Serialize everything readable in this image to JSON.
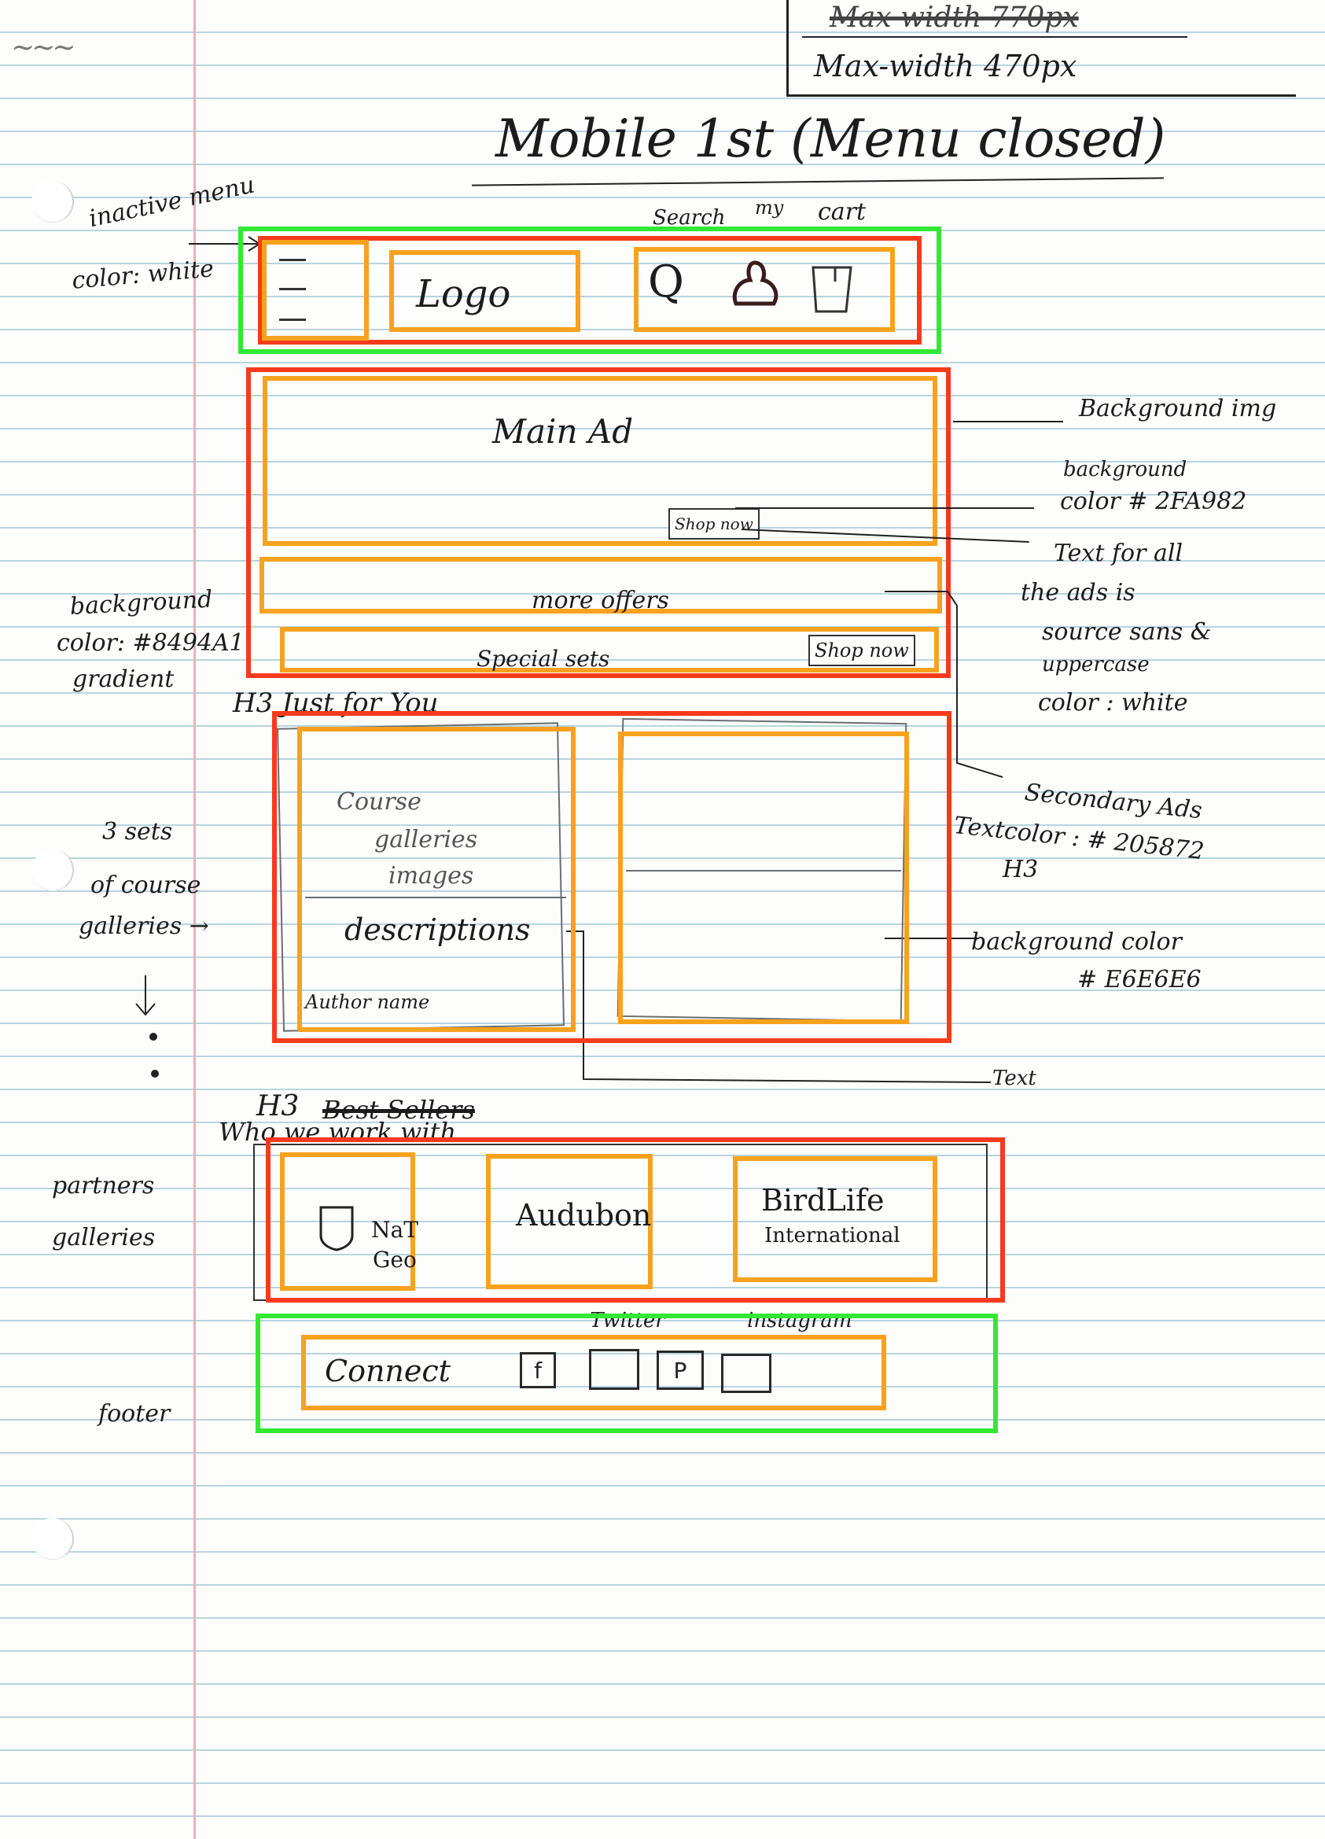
{
  "top_right_box": {
    "struck": "Max-width 770px",
    "value": "Max-width  470px"
  },
  "page_title": "Mobile 1st  (Menu closed)",
  "scribble_mark": "~~~",
  "left_notes": {
    "inactive_menu": "inactive menu",
    "color_white": "color: white",
    "background": "background",
    "color_hex": "color: #8494A1",
    "gradient": "gradient",
    "three_sets": "3 sets",
    "of_course": "of course",
    "galleries": "galleries →",
    "partners": "partners",
    "partners_galleries": "galleries",
    "footer": "footer"
  },
  "header": {
    "label_search": "Search",
    "label_my": "my",
    "label_cart": "cart",
    "logo": "Logo",
    "search_glyph": "Q"
  },
  "ads": {
    "main_ad": "Main Ad",
    "shop_now_small": "Shop now",
    "more_offers": "more offers",
    "special_sets": "Special sets",
    "shop_now": "Shop now"
  },
  "right_notes": {
    "background_img": "Background img",
    "background": "background",
    "color_hex": "color # 2FA982",
    "text_for_all": "Text for all",
    "the_ads_is": "the ads is",
    "source_sans": "source sans &",
    "uppercase": "uppercase",
    "color_white": "color : white",
    "secondary_ads": "Secondary Ads",
    "textcolor": "Textcolor : # 205872",
    "h3": "H3",
    "background_color": "background color",
    "bg_hex": "# E6E6E6",
    "text": "Text"
  },
  "gallery": {
    "heading": "H3  Just for You",
    "course": "Course",
    "galleries": "galleries",
    "images": "images",
    "descriptions": "descriptions",
    "author": "Author name"
  },
  "partners": {
    "heading_h3": "H3",
    "heading_struck": "Best Sellers",
    "heading_sub": "Who we work with",
    "natgeo_1": "NaT",
    "natgeo_2": "Geo",
    "audubon": "Audubon",
    "birdlife_1": "BirdLife",
    "birdlife_2": "International"
  },
  "footer": {
    "twitter": "Twitter",
    "instagram": "instagram",
    "connect": "Connect",
    "facebook_glyph": "f",
    "pinterest_glyph": "P"
  }
}
